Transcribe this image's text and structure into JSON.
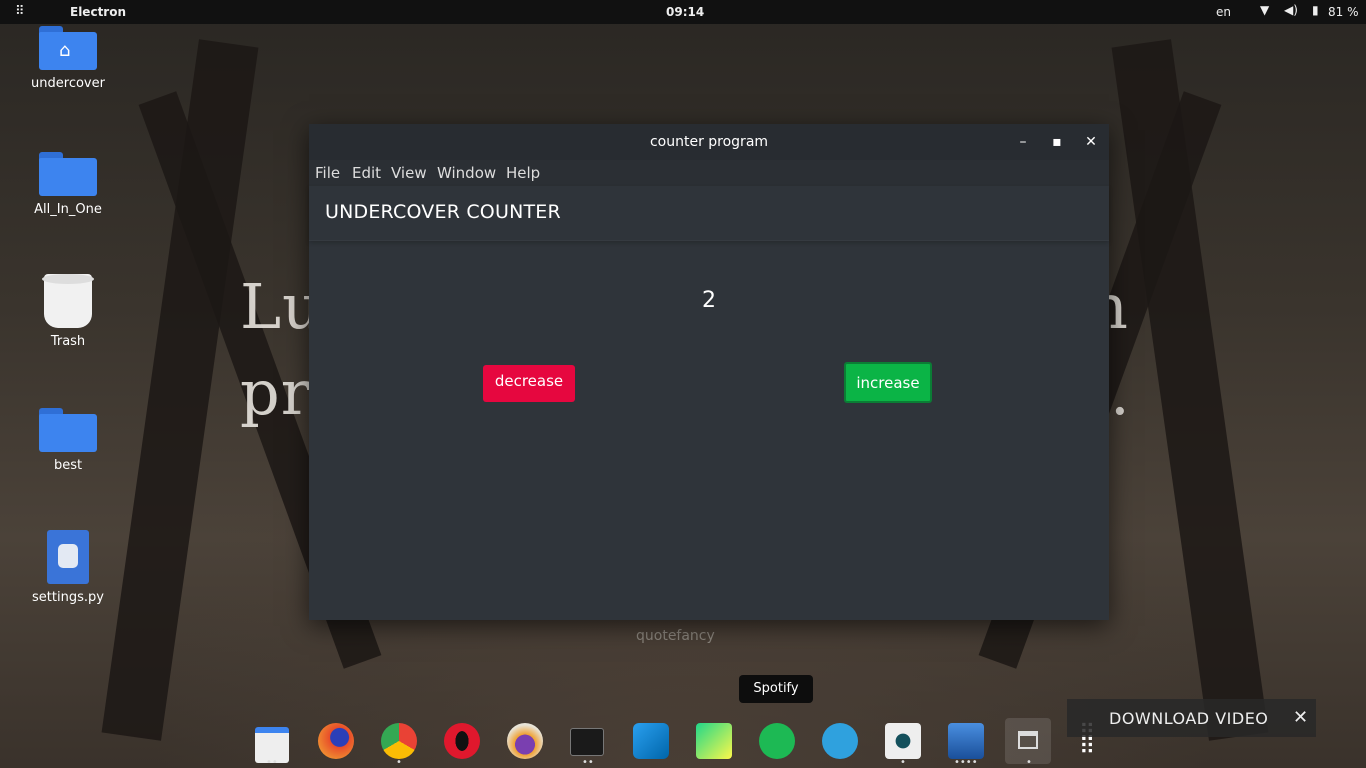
{
  "topbar": {
    "app_name": "Electron",
    "clock": "09:14",
    "language": "en",
    "battery": "81 %"
  },
  "wallpaper": {
    "quote_line1": "Lu",
    "quote_line1_end": "n",
    "quote_line2": "pre",
    "quote_line2_end": ".",
    "watermark": "quotefancy"
  },
  "desktop": {
    "icons": [
      {
        "label": "undercover",
        "icon": "home-folder-icon"
      },
      {
        "label": "All_In_One",
        "icon": "folder-icon"
      },
      {
        "label": "Trash",
        "icon": "trash-icon"
      },
      {
        "label": "best",
        "icon": "folder-icon"
      },
      {
        "label": "settings.py",
        "icon": "python-file-icon"
      }
    ]
  },
  "window": {
    "title": "counter program",
    "menu": [
      "File",
      "Edit",
      "View",
      "Window",
      "Help"
    ],
    "header": "UNDERCOVER COUNTER",
    "count": "2",
    "decrease_label": "decrease",
    "increase_label": "increase"
  },
  "dock": {
    "apps": [
      "files-icon",
      "firefox-icon",
      "chrome-icon",
      "opera-icon",
      "tor-icon",
      "terminal-icon",
      "vscode-icon",
      "pycharm-icon",
      "spotify-icon",
      "telegram-icon",
      "music-player-icon",
      "downloader-icon",
      "window-icon",
      "app-grid-icon"
    ],
    "tooltip": "Spotify"
  },
  "download_bar": {
    "label": "DOWNLOAD VIDEO",
    "close": "✕"
  },
  "colors": {
    "decrease": "#e6073f",
    "increase": "#0bb446",
    "window_bg": "#2f343a"
  }
}
